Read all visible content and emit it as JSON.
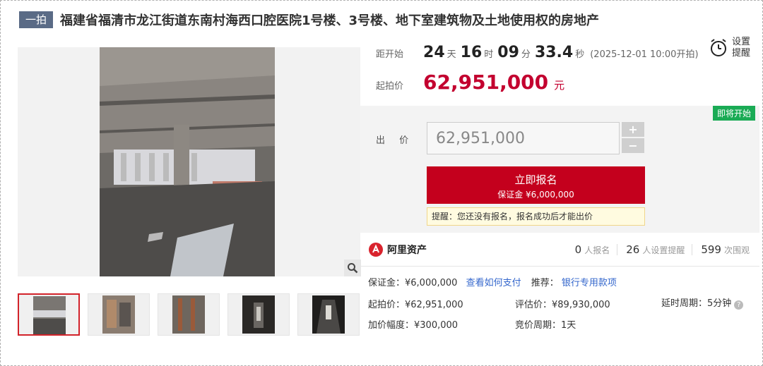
{
  "header": {
    "tag": "一拍",
    "title": "福建省福清市龙江街道东南村海西口腔医院1号楼、3号楼、地下室建筑物及土地使用权的房地产"
  },
  "countdown": {
    "label": "距开始",
    "days": "24",
    "days_unit": "天",
    "hours": "16",
    "hours_unit": "时",
    "minutes": "09",
    "minutes_unit": "分",
    "seconds": "33.4",
    "seconds_unit": "秒",
    "start_time": "(2025-12-01 10:00开拍)"
  },
  "reminder": {
    "label": "设置提醒",
    "icon": "alarm-clock-icon"
  },
  "start_price": {
    "label": "起拍价",
    "value": "62,951,000",
    "unit": "元"
  },
  "bid": {
    "badge": "即将开始",
    "label": "出 价",
    "input_value": "62,951,000",
    "plus": "+",
    "minus": "−",
    "signup_label": "立即报名",
    "deposit_label": "保证金 ¥6,000,000",
    "tip": "提醒：您还没有报名，报名成功后才能出价"
  },
  "platform": {
    "name": "阿里资产"
  },
  "stats": [
    {
      "value": "0",
      "unit": "人报名"
    },
    {
      "value": "26",
      "unit": "人设置提醒"
    },
    {
      "value": "599",
      "unit": "次围观"
    }
  ],
  "info": {
    "deposit": "保证金：¥6,000,000",
    "how_to_pay": "查看如何支付",
    "recommend_label": "推荐：",
    "recommend_link": "银行专用款项",
    "start_price": "起拍价：¥62,951,000",
    "appraisal": "评估价：¥89,930,000",
    "delay": "延时周期：5分钟",
    "increment": "加价幅度：¥300,000",
    "cycle": "竞价周期：1天"
  },
  "colors": {
    "accent": "#c4001d",
    "badge": "#1aab55",
    "tag": "#5a6b86",
    "link": "#3366cc"
  }
}
